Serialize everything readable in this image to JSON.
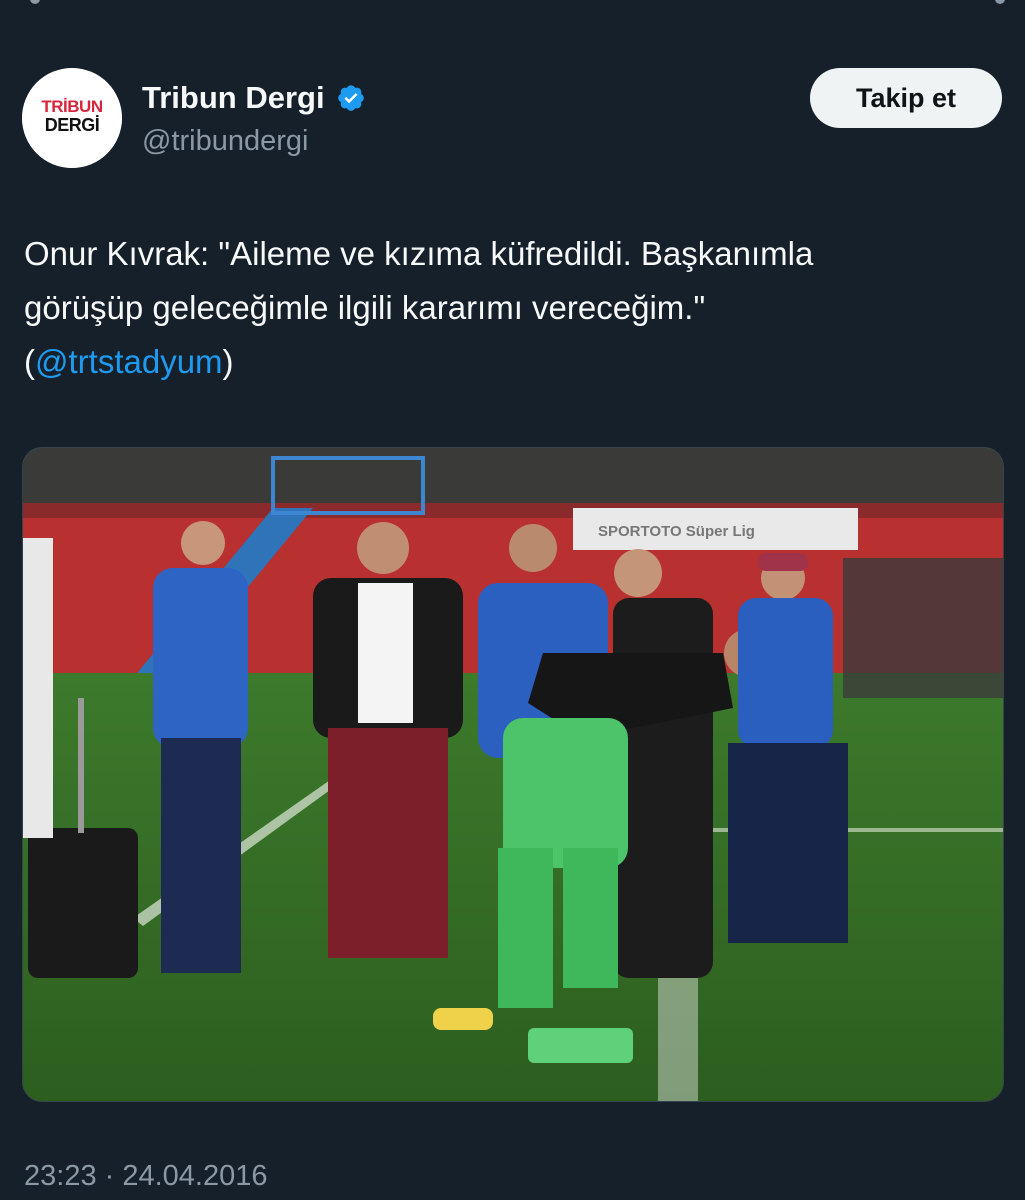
{
  "tweet": {
    "author": {
      "display_name": "Tribun Dergi",
      "handle": "@tribundergi",
      "verified": true,
      "avatar_logo_text": [
        "TRİBUN",
        "DERGİ"
      ]
    },
    "follow_label": "Takip et",
    "text_lines": [
      "Onur Kıvrak: \"Aileme ve kızıma küfredildi. Başkanımla",
      "görüşüp geleceğimle ilgili kararımı vereceğim.\""
    ],
    "text_mention": {
      "open": "(",
      "mention": "@trtstadyum",
      "close": ")"
    },
    "media": {
      "description_icon": "photo",
      "billboard_text": "SPORTOTO Süper Lig"
    },
    "timestamp": "23:23 · 24.04.2016"
  },
  "colors": {
    "background": "#15202b",
    "text_primary": "#f7f9f9",
    "text_secondary": "#8b98a5",
    "link": "#1d9bf0",
    "verified_badge": "#1d9bf0",
    "follow_button_bg": "#eff3f4"
  }
}
